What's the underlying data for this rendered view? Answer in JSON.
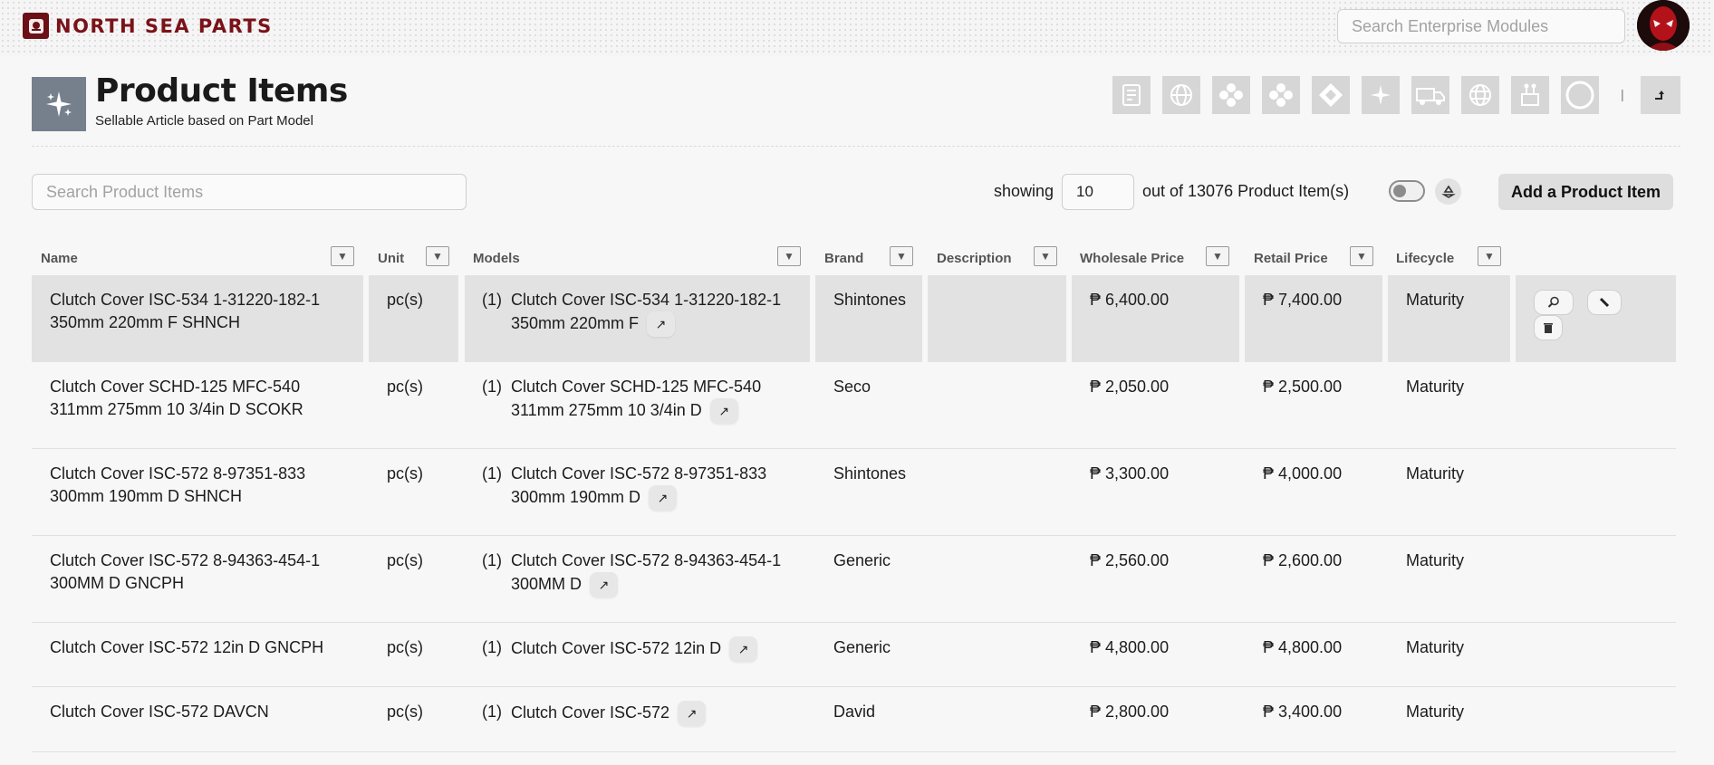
{
  "brand": {
    "name": "NORTH SEA PARTS"
  },
  "global_search": {
    "placeholder": "Search Enterprise Modules"
  },
  "page": {
    "title": "Product Items",
    "subtitle": "Sellable Article based on Part Model"
  },
  "toolbar": {
    "module_icons": [
      "document-icon",
      "globe-icon",
      "dots-cluster-icon",
      "dots-cluster-icon",
      "diamond-icon",
      "sparkle-icon",
      "truck-icon",
      "globe-icon",
      "tools-icon",
      "ring-icon"
    ],
    "separator": "|"
  },
  "list_controls": {
    "search_placeholder": "Search Product Items",
    "showing_label": "showing",
    "page_size": "10",
    "total_label": "out of 13076 Product Item(s)",
    "add_button": "Add a Product Item"
  },
  "columns": [
    "Name",
    "Unit",
    "Models",
    "Brand",
    "Description",
    "Wholesale Price",
    "Retail Price",
    "Lifecycle"
  ],
  "rows": [
    {
      "name": "Clutch Cover ISC-534 1-31220-182-1 350mm 220mm F SHNCH",
      "unit": "pc(s)",
      "model_count": "(1)",
      "model": "Clutch Cover ISC-534 1-31220-182-1 350mm 220mm F",
      "brand": "Shintones",
      "description": "",
      "wholesale": "₱ 6,400.00",
      "retail": "₱ 7,400.00",
      "lifecycle": "Maturity"
    },
    {
      "name": "Clutch Cover SCHD-125 MFC-540 311mm 275mm 10 3/4in D SCOKR",
      "unit": "pc(s)",
      "model_count": "(1)",
      "model": "Clutch Cover SCHD-125 MFC-540 311mm 275mm 10 3/4in D",
      "brand": "Seco",
      "description": "",
      "wholesale": "₱ 2,050.00",
      "retail": "₱ 2,500.00",
      "lifecycle": "Maturity"
    },
    {
      "name": "Clutch Cover ISC-572 8-97351-833 300mm 190mm D SHNCH",
      "unit": "pc(s)",
      "model_count": "(1)",
      "model": "Clutch Cover ISC-572 8-97351-833 300mm 190mm D",
      "brand": "Shintones",
      "description": "",
      "wholesale": "₱ 3,300.00",
      "retail": "₱ 4,000.00",
      "lifecycle": "Maturity"
    },
    {
      "name": "Clutch Cover ISC-572 8-94363-454-1 300MM D GNCPH",
      "unit": "pc(s)",
      "model_count": "(1)",
      "model": "Clutch Cover ISC-572 8-94363-454-1 300MM D",
      "brand": "Generic",
      "description": "",
      "wholesale": "₱ 2,560.00",
      "retail": "₱ 2,600.00",
      "lifecycle": "Maturity"
    },
    {
      "name": "Clutch Cover ISC-572 12in D GNCPH",
      "unit": "pc(s)",
      "model_count": "(1)",
      "model": "Clutch Cover ISC-572 12in D",
      "brand": "Generic",
      "description": "",
      "wholesale": "₱ 4,800.00",
      "retail": "₱ 4,800.00",
      "lifecycle": "Maturity"
    },
    {
      "name": "Clutch Cover ISC-572 DAVCN",
      "unit": "pc(s)",
      "model_count": "(1)",
      "model": "Clutch Cover ISC-572",
      "brand": "David",
      "description": "",
      "wholesale": "₱ 2,800.00",
      "retail": "₱ 3,400.00",
      "lifecycle": "Maturity"
    }
  ],
  "colors": {
    "brand": "#7a1218",
    "selected_row": "#e2e2e2",
    "page_icon_bg": "#767f8c"
  }
}
